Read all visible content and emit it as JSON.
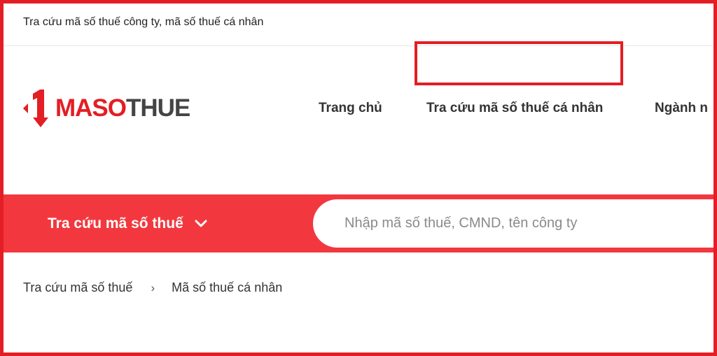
{
  "topbar": {
    "text": "Tra cứu mã số thuế công ty, mã số thuế cá nhân"
  },
  "logo": {
    "brand_red": "MASO",
    "brand_gray": "THUE",
    "icon": "arrow-one-logo-icon"
  },
  "nav": {
    "items": [
      {
        "label": "Trang chủ"
      },
      {
        "label": "Tra cứu mã số thuế cá nhân"
      },
      {
        "label": "Ngành n"
      }
    ]
  },
  "search": {
    "dropdown_label": "Tra cứu mã số thuế",
    "dropdown_icon": "chevron-down-icon",
    "placeholder": "Nhập mã số thuế, CMND, tên công ty"
  },
  "breadcrumb": {
    "items": [
      {
        "label": "Tra cứu mã số thuế"
      },
      {
        "label": "Mã số thuế cá nhân"
      }
    ],
    "separator": "›"
  },
  "colors": {
    "accent": "#e31e24",
    "band": "#f2383e",
    "text": "#333333"
  }
}
